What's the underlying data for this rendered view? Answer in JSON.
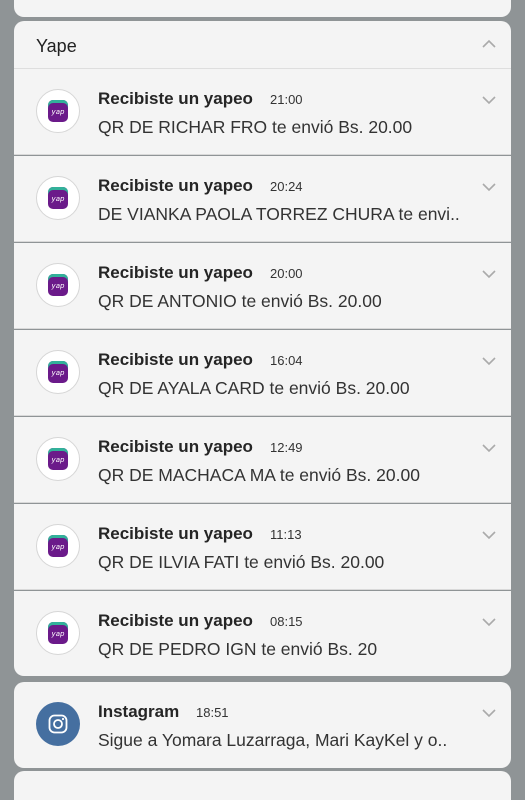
{
  "group": {
    "title": "Yape"
  },
  "notifications": [
    {
      "title": "Recibiste un yapeo",
      "time": "21:00",
      "body": "QR DE RICHAR FRO te envió Bs. 20.00",
      "icon": "yape-icon"
    },
    {
      "title": "Recibiste un yapeo",
      "time": "20:24",
      "body": "DE VIANKA PAOLA TORREZ CHURA te envi..",
      "icon": "yape-icon"
    },
    {
      "title": "Recibiste un yapeo",
      "time": "20:00",
      "body": "QR DE ANTONIO te envió Bs. 20.00",
      "icon": "yape-icon"
    },
    {
      "title": "Recibiste un yapeo",
      "time": "16:04",
      "body": "QR DE AYALA CARD te envió Bs. 20.00",
      "icon": "yape-icon"
    },
    {
      "title": "Recibiste un yapeo",
      "time": "12:49",
      "body": "QR DE MACHACA MA te envió Bs. 20.00",
      "icon": "yape-icon"
    },
    {
      "title": "Recibiste un yapeo",
      "time": "11:13",
      "body": "QR DE ILVIA FATI te envió Bs. 20.00",
      "icon": "yape-icon"
    },
    {
      "title": "Recibiste un yapeo",
      "time": "08:15",
      "body": "QR DE PEDRO IGN te envió Bs. 20",
      "icon": "yape-icon"
    }
  ],
  "instagram": {
    "title": "Instagram",
    "time": "18:51",
    "body": "Sigue a Yomara Luzarraga, Mari KayKel y o..",
    "icon": "instagram-icon"
  },
  "colors": {
    "background": "#8f9496",
    "card": "#f4f4f4",
    "yape_purple": "#6b1a8a",
    "yape_teal": "#32b19a",
    "instagram_blue": "#456fa0"
  },
  "yape_logo_text": "yap"
}
